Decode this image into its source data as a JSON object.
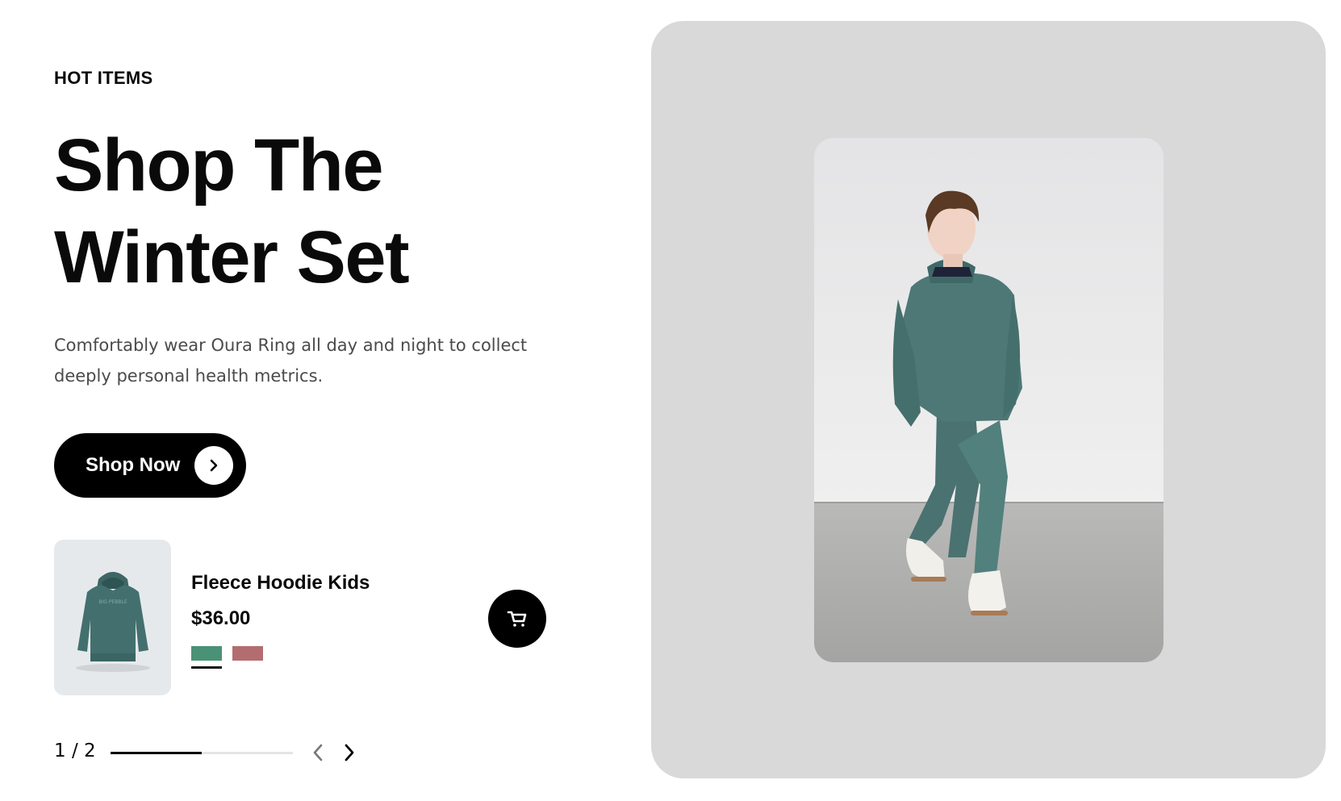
{
  "hero": {
    "eyebrow": "HOT ITEMS",
    "headline_line1": "Shop The",
    "headline_line2": "Winter Set",
    "description": "Comfortably wear Oura Ring all day and night to collect deeply personal health metrics.",
    "cta_label": "Shop Now",
    "cta_icon": "chevron-right-icon"
  },
  "product": {
    "name": "Fleece Hoodie Kids",
    "price": "$36.00",
    "swatches": [
      {
        "name": "green",
        "color": "#4a9277",
        "selected": true
      },
      {
        "name": "red",
        "color": "#b36d70",
        "selected": false
      }
    ],
    "cart_icon": "cart-icon"
  },
  "pager": {
    "label": "1 / 2",
    "current": 1,
    "total": 2,
    "progress": 0.5,
    "prev_icon": "chevron-left-icon",
    "next_icon": "chevron-right-icon"
  },
  "colors": {
    "accent": "#000000",
    "panel_bg": "#d9d9da",
    "description_text": "#4b4b4b"
  }
}
